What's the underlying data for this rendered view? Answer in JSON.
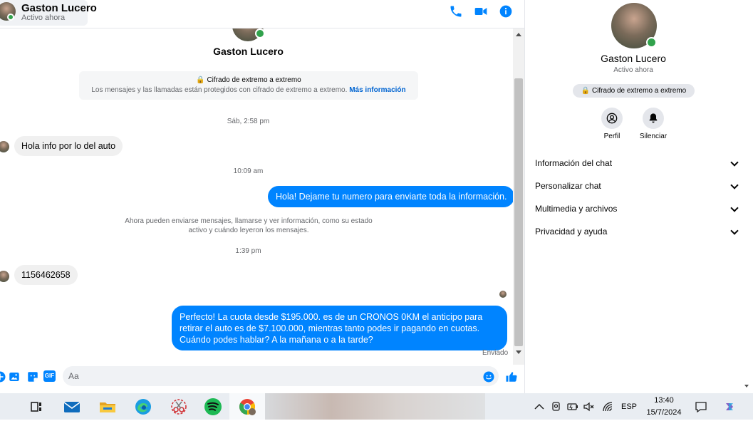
{
  "colors": {
    "accent": "#0084ff",
    "online": "#31a24c",
    "bubble_in": "#f0f0f0",
    "link": "#0064d1"
  },
  "header": {
    "name": "Gaston Lucero",
    "status": "Activo ahora",
    "icons": [
      "phone-icon",
      "video-icon",
      "info-icon"
    ]
  },
  "conversation": {
    "contact_name": "Gaston Lucero",
    "e2e_title": "🔒 Cifrado de extremo a extremo",
    "e2e_desc": "Los mensajes y las llamadas están protegidos con cifrado de extremo a extremo.",
    "e2e_link": "Más información",
    "timestamps": [
      "Sáb, 2:58 pm",
      "10:09 am",
      "1:39 pm"
    ],
    "messages": [
      {
        "direction": "in",
        "text": "Hola info por lo del auto"
      },
      {
        "direction": "out",
        "text": "Hola! Dejame tu numero  para enviarte toda la información."
      },
      {
        "direction": "in",
        "text": "1156462658"
      },
      {
        "direction": "out",
        "text": "Perfecto! La cuota desde $195.000. es de un CRONOS 0KM el anticipo para retirar el auto es de $7.100.000, mientras tanto podes ir pagando en cuotas. Cuándo podes hablar? A la mañana o a la tarde?"
      }
    ],
    "notice": "Ahora pueden enviarse mensajes, llamarse y ver información, como su estado activo y cuándo leyeron los mensajes.",
    "sent_label": "Enviado"
  },
  "composer": {
    "placeholder": "Aa",
    "gif_label": "GIF",
    "icons": [
      "add-icon",
      "image-icon",
      "sticker-icon",
      "gif-icon",
      "emoji-icon",
      "like-icon"
    ]
  },
  "info_panel": {
    "name": "Gaston Lucero",
    "status": "Activo ahora",
    "e2e_label": "🔒 Cifrado de extremo a extremo",
    "actions": [
      {
        "label": "Perfil",
        "icon": "profile-icon"
      },
      {
        "label": "Silenciar",
        "icon": "bell-icon"
      }
    ],
    "sections": [
      "Información del chat",
      "Personalizar chat",
      "Multimedia y archivos",
      "Privacidad y ayuda"
    ]
  },
  "taskbar": {
    "apps": [
      "task-view-icon",
      "mail-icon",
      "file-explorer-icon",
      "edge-icon",
      "snipping-tool-icon",
      "spotify-icon",
      "chrome-icon"
    ],
    "tray_icons": [
      "chevron-up-icon",
      "meet-icon",
      "battery-icon",
      "mute-icon",
      "wifi-icon"
    ],
    "language": "ESP",
    "time": "13:40",
    "date": "15/7/2024"
  }
}
